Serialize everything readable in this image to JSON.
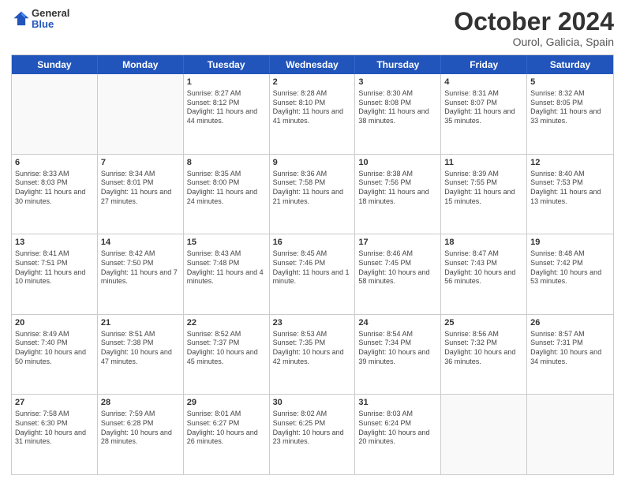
{
  "header": {
    "logo": {
      "line1": "General",
      "line2": "Blue"
    },
    "title": "October 2024",
    "subtitle": "Ourol, Galicia, Spain"
  },
  "days_of_week": [
    "Sunday",
    "Monday",
    "Tuesday",
    "Wednesday",
    "Thursday",
    "Friday",
    "Saturday"
  ],
  "weeks": [
    [
      {
        "day": "",
        "empty": true
      },
      {
        "day": "",
        "empty": true
      },
      {
        "day": "1",
        "sunrise": "Sunrise: 8:27 AM",
        "sunset": "Sunset: 8:12 PM",
        "daylight": "Daylight: 11 hours and 44 minutes."
      },
      {
        "day": "2",
        "sunrise": "Sunrise: 8:28 AM",
        "sunset": "Sunset: 8:10 PM",
        "daylight": "Daylight: 11 hours and 41 minutes."
      },
      {
        "day": "3",
        "sunrise": "Sunrise: 8:30 AM",
        "sunset": "Sunset: 8:08 PM",
        "daylight": "Daylight: 11 hours and 38 minutes."
      },
      {
        "day": "4",
        "sunrise": "Sunrise: 8:31 AM",
        "sunset": "Sunset: 8:07 PM",
        "daylight": "Daylight: 11 hours and 35 minutes."
      },
      {
        "day": "5",
        "sunrise": "Sunrise: 8:32 AM",
        "sunset": "Sunset: 8:05 PM",
        "daylight": "Daylight: 11 hours and 33 minutes."
      }
    ],
    [
      {
        "day": "6",
        "sunrise": "Sunrise: 8:33 AM",
        "sunset": "Sunset: 8:03 PM",
        "daylight": "Daylight: 11 hours and 30 minutes."
      },
      {
        "day": "7",
        "sunrise": "Sunrise: 8:34 AM",
        "sunset": "Sunset: 8:01 PM",
        "daylight": "Daylight: 11 hours and 27 minutes."
      },
      {
        "day": "8",
        "sunrise": "Sunrise: 8:35 AM",
        "sunset": "Sunset: 8:00 PM",
        "daylight": "Daylight: 11 hours and 24 minutes."
      },
      {
        "day": "9",
        "sunrise": "Sunrise: 8:36 AM",
        "sunset": "Sunset: 7:58 PM",
        "daylight": "Daylight: 11 hours and 21 minutes."
      },
      {
        "day": "10",
        "sunrise": "Sunrise: 8:38 AM",
        "sunset": "Sunset: 7:56 PM",
        "daylight": "Daylight: 11 hours and 18 minutes."
      },
      {
        "day": "11",
        "sunrise": "Sunrise: 8:39 AM",
        "sunset": "Sunset: 7:55 PM",
        "daylight": "Daylight: 11 hours and 15 minutes."
      },
      {
        "day": "12",
        "sunrise": "Sunrise: 8:40 AM",
        "sunset": "Sunset: 7:53 PM",
        "daylight": "Daylight: 11 hours and 13 minutes."
      }
    ],
    [
      {
        "day": "13",
        "sunrise": "Sunrise: 8:41 AM",
        "sunset": "Sunset: 7:51 PM",
        "daylight": "Daylight: 11 hours and 10 minutes."
      },
      {
        "day": "14",
        "sunrise": "Sunrise: 8:42 AM",
        "sunset": "Sunset: 7:50 PM",
        "daylight": "Daylight: 11 hours and 7 minutes."
      },
      {
        "day": "15",
        "sunrise": "Sunrise: 8:43 AM",
        "sunset": "Sunset: 7:48 PM",
        "daylight": "Daylight: 11 hours and 4 minutes."
      },
      {
        "day": "16",
        "sunrise": "Sunrise: 8:45 AM",
        "sunset": "Sunset: 7:46 PM",
        "daylight": "Daylight: 11 hours and 1 minute."
      },
      {
        "day": "17",
        "sunrise": "Sunrise: 8:46 AM",
        "sunset": "Sunset: 7:45 PM",
        "daylight": "Daylight: 10 hours and 58 minutes."
      },
      {
        "day": "18",
        "sunrise": "Sunrise: 8:47 AM",
        "sunset": "Sunset: 7:43 PM",
        "daylight": "Daylight: 10 hours and 56 minutes."
      },
      {
        "day": "19",
        "sunrise": "Sunrise: 8:48 AM",
        "sunset": "Sunset: 7:42 PM",
        "daylight": "Daylight: 10 hours and 53 minutes."
      }
    ],
    [
      {
        "day": "20",
        "sunrise": "Sunrise: 8:49 AM",
        "sunset": "Sunset: 7:40 PM",
        "daylight": "Daylight: 10 hours and 50 minutes."
      },
      {
        "day": "21",
        "sunrise": "Sunrise: 8:51 AM",
        "sunset": "Sunset: 7:38 PM",
        "daylight": "Daylight: 10 hours and 47 minutes."
      },
      {
        "day": "22",
        "sunrise": "Sunrise: 8:52 AM",
        "sunset": "Sunset: 7:37 PM",
        "daylight": "Daylight: 10 hours and 45 minutes."
      },
      {
        "day": "23",
        "sunrise": "Sunrise: 8:53 AM",
        "sunset": "Sunset: 7:35 PM",
        "daylight": "Daylight: 10 hours and 42 minutes."
      },
      {
        "day": "24",
        "sunrise": "Sunrise: 8:54 AM",
        "sunset": "Sunset: 7:34 PM",
        "daylight": "Daylight: 10 hours and 39 minutes."
      },
      {
        "day": "25",
        "sunrise": "Sunrise: 8:56 AM",
        "sunset": "Sunset: 7:32 PM",
        "daylight": "Daylight: 10 hours and 36 minutes."
      },
      {
        "day": "26",
        "sunrise": "Sunrise: 8:57 AM",
        "sunset": "Sunset: 7:31 PM",
        "daylight": "Daylight: 10 hours and 34 minutes."
      }
    ],
    [
      {
        "day": "27",
        "sunrise": "Sunrise: 7:58 AM",
        "sunset": "Sunset: 6:30 PM",
        "daylight": "Daylight: 10 hours and 31 minutes."
      },
      {
        "day": "28",
        "sunrise": "Sunrise: 7:59 AM",
        "sunset": "Sunset: 6:28 PM",
        "daylight": "Daylight: 10 hours and 28 minutes."
      },
      {
        "day": "29",
        "sunrise": "Sunrise: 8:01 AM",
        "sunset": "Sunset: 6:27 PM",
        "daylight": "Daylight: 10 hours and 26 minutes."
      },
      {
        "day": "30",
        "sunrise": "Sunrise: 8:02 AM",
        "sunset": "Sunset: 6:25 PM",
        "daylight": "Daylight: 10 hours and 23 minutes."
      },
      {
        "day": "31",
        "sunrise": "Sunrise: 8:03 AM",
        "sunset": "Sunset: 6:24 PM",
        "daylight": "Daylight: 10 hours and 20 minutes."
      },
      {
        "day": "",
        "empty": true
      },
      {
        "day": "",
        "empty": true
      }
    ]
  ]
}
